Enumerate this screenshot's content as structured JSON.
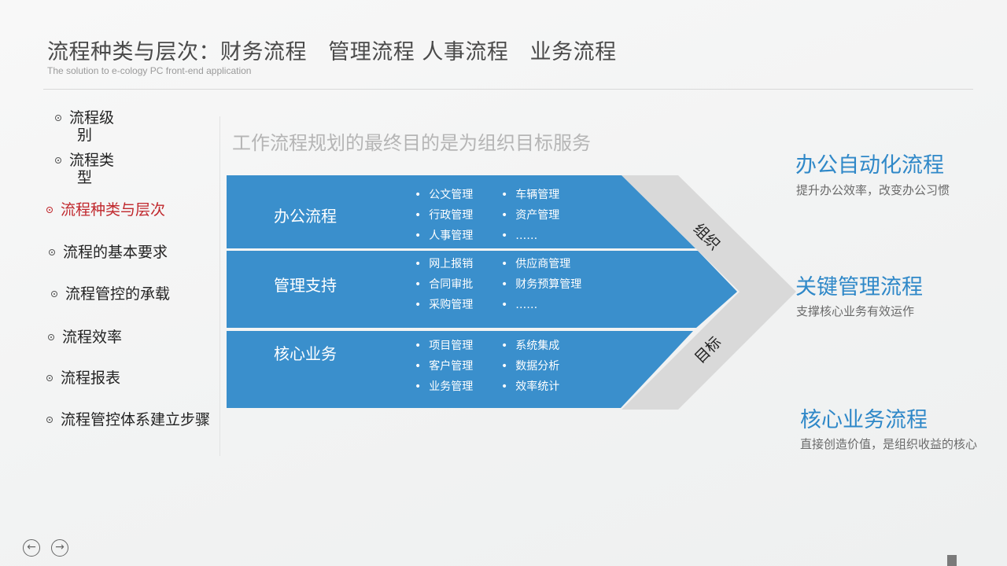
{
  "header": {
    "title": "流程种类与层次：财务流程   管理流程 人事流程   业务流程",
    "subtitle": "The solution to e-cology PC front-end application"
  },
  "sidebar": {
    "items": [
      {
        "label_a": "流程级",
        "label_b": "别"
      },
      {
        "label_a": "流程类",
        "label_b": "型"
      },
      {
        "label": "流程种类与层次",
        "active": true
      },
      {
        "label": "流程的基本要求"
      },
      {
        "label": "流程管控的承载"
      },
      {
        "label": "流程效率"
      },
      {
        "label": "流程报表"
      },
      {
        "label": "流程管控体系建立步骤"
      }
    ]
  },
  "main": {
    "heading": "工作流程规划的最终目的是为组织目标服务",
    "bands": [
      {
        "title": "办公流程",
        "items": [
          "公文管理",
          "车辆管理",
          "行政管理",
          "资产管理",
          "人事管理",
          "……"
        ]
      },
      {
        "title": "管理支持",
        "items": [
          "网上报销",
          "供应商管理",
          "合同审批",
          "财务预算管理",
          "采购管理",
          "……"
        ]
      },
      {
        "title": "核心业务",
        "items": [
          "项目管理",
          "系统集成",
          "客户管理",
          "数据分析",
          "业务管理",
          "效率统计"
        ]
      }
    ],
    "chevron_labels": {
      "top": "组织",
      "bottom": "目标"
    }
  },
  "right": [
    {
      "title": "办公自动化流程",
      "desc": "提升办公效率，改变办公习惯"
    },
    {
      "title": "关键管理流程",
      "desc": "支撑核心业务有效运作"
    },
    {
      "title": "核心业务流程",
      "desc": "直接创造价值，是组织收益的核心"
    }
  ],
  "colors": {
    "band": "#3a8fcc",
    "chevron": "#d9d9d9",
    "accent": "#2f88c8",
    "active": "#c0282d"
  },
  "footer": {
    "prev_icon": "arrow-left-circle-icon",
    "next_icon": "arrow-right-circle-icon",
    "prev_glyph": "←",
    "next_glyph": "→"
  }
}
